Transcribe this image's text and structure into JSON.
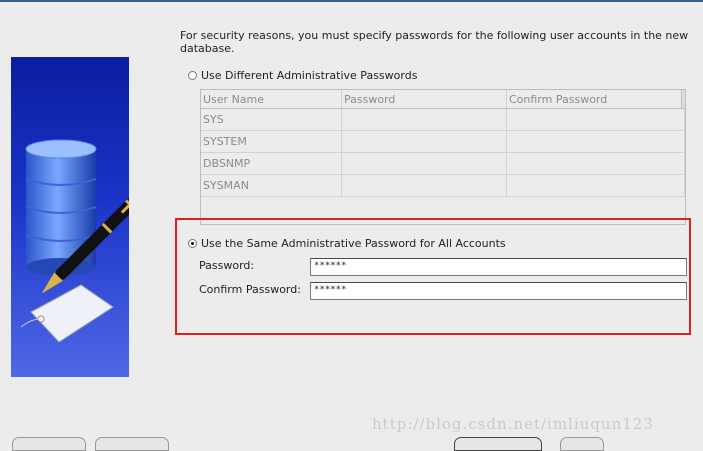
{
  "intro_text": "For security reasons, you must specify passwords for the following user accounts in the new database.",
  "option_different": {
    "label": "Use Different Administrative Passwords",
    "selected": false
  },
  "table": {
    "columns": [
      "User Name",
      "Password",
      "Confirm Password"
    ],
    "rows": [
      {
        "user": "SYS",
        "password": "",
        "confirm": ""
      },
      {
        "user": "SYSTEM",
        "password": "",
        "confirm": ""
      },
      {
        "user": "DBSNMP",
        "password": "",
        "confirm": ""
      },
      {
        "user": "SYSMAN",
        "password": "",
        "confirm": ""
      }
    ]
  },
  "option_same": {
    "label": "Use the Same Administrative Password for All Accounts",
    "selected": true
  },
  "password": {
    "label": "Password:",
    "value": "******"
  },
  "confirm_password": {
    "label": "Confirm Password:",
    "value": "******"
  },
  "watermark": "http://blog.csdn.net/imliuqun123",
  "colors": {
    "highlight_border": "#e02020",
    "banner_blue": "#1b34c8"
  },
  "icons": {
    "banner": "database-with-pen-illustration"
  }
}
